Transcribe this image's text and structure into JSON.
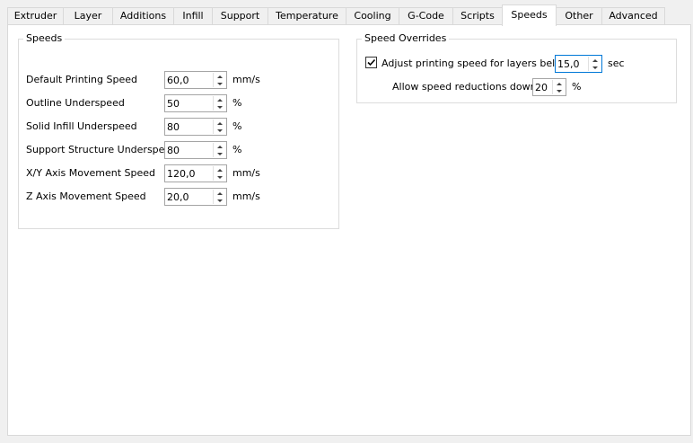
{
  "tabs": [
    {
      "label": "Extruder"
    },
    {
      "label": "Layer"
    },
    {
      "label": "Additions"
    },
    {
      "label": "Infill"
    },
    {
      "label": "Support"
    },
    {
      "label": "Temperature"
    },
    {
      "label": "Cooling"
    },
    {
      "label": "G-Code"
    },
    {
      "label": "Scripts"
    },
    {
      "label": "Speeds"
    },
    {
      "label": "Other"
    },
    {
      "label": "Advanced"
    }
  ],
  "active_tab": "Speeds",
  "speeds_group": {
    "title": "Speeds",
    "fields": [
      {
        "label": "Default Printing Speed",
        "value": "60,0",
        "unit": "mm/s"
      },
      {
        "label": "Outline Underspeed",
        "value": "50",
        "unit": "%"
      },
      {
        "label": "Solid Infill Underspeed",
        "value": "80",
        "unit": "%"
      },
      {
        "label": "Support Structure Underspeed",
        "value": "80",
        "unit": "%"
      },
      {
        "label": "X/Y Axis Movement Speed",
        "value": "120,0",
        "unit": "mm/s"
      },
      {
        "label": "Z Axis Movement Speed",
        "value": "20,0",
        "unit": "mm/s"
      }
    ]
  },
  "overrides_group": {
    "title": "Speed Overrides",
    "adjust": {
      "label": "Adjust printing speed for layers below",
      "checked": true,
      "value": "15,0",
      "unit": "sec"
    },
    "reduction": {
      "label": "Allow speed reductions down to",
      "value": "20",
      "unit": "%"
    }
  }
}
